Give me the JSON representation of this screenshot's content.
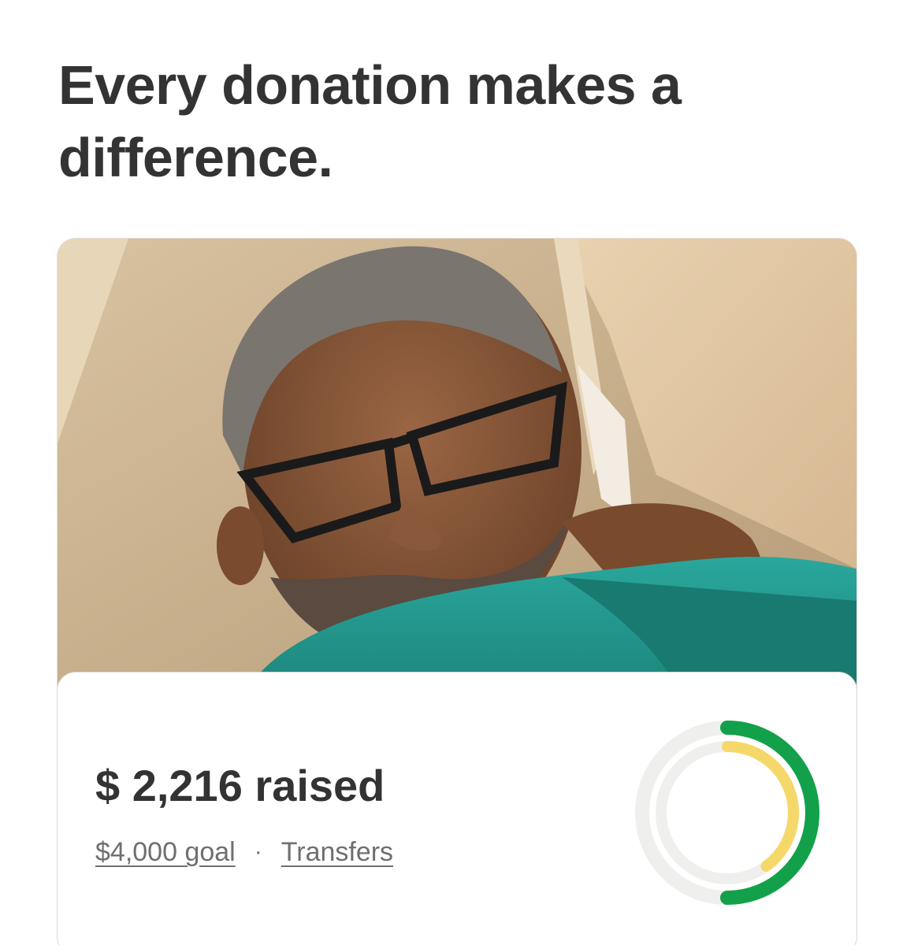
{
  "headline": "Every donation makes a difference.",
  "fundraiser": {
    "raised_label": "$ 2,216 raised",
    "raised_amount": 2216,
    "goal_amount": 4000,
    "goal_label": "$4,000 goal",
    "separator": "·",
    "transfers_label": "Transfers"
  },
  "progress_ring": {
    "outer_fraction": 0.5,
    "inner_fraction": 0.4,
    "colors": {
      "outer": "#12a14a",
      "inner": "#f5d86a",
      "track": "#efefed"
    }
  }
}
